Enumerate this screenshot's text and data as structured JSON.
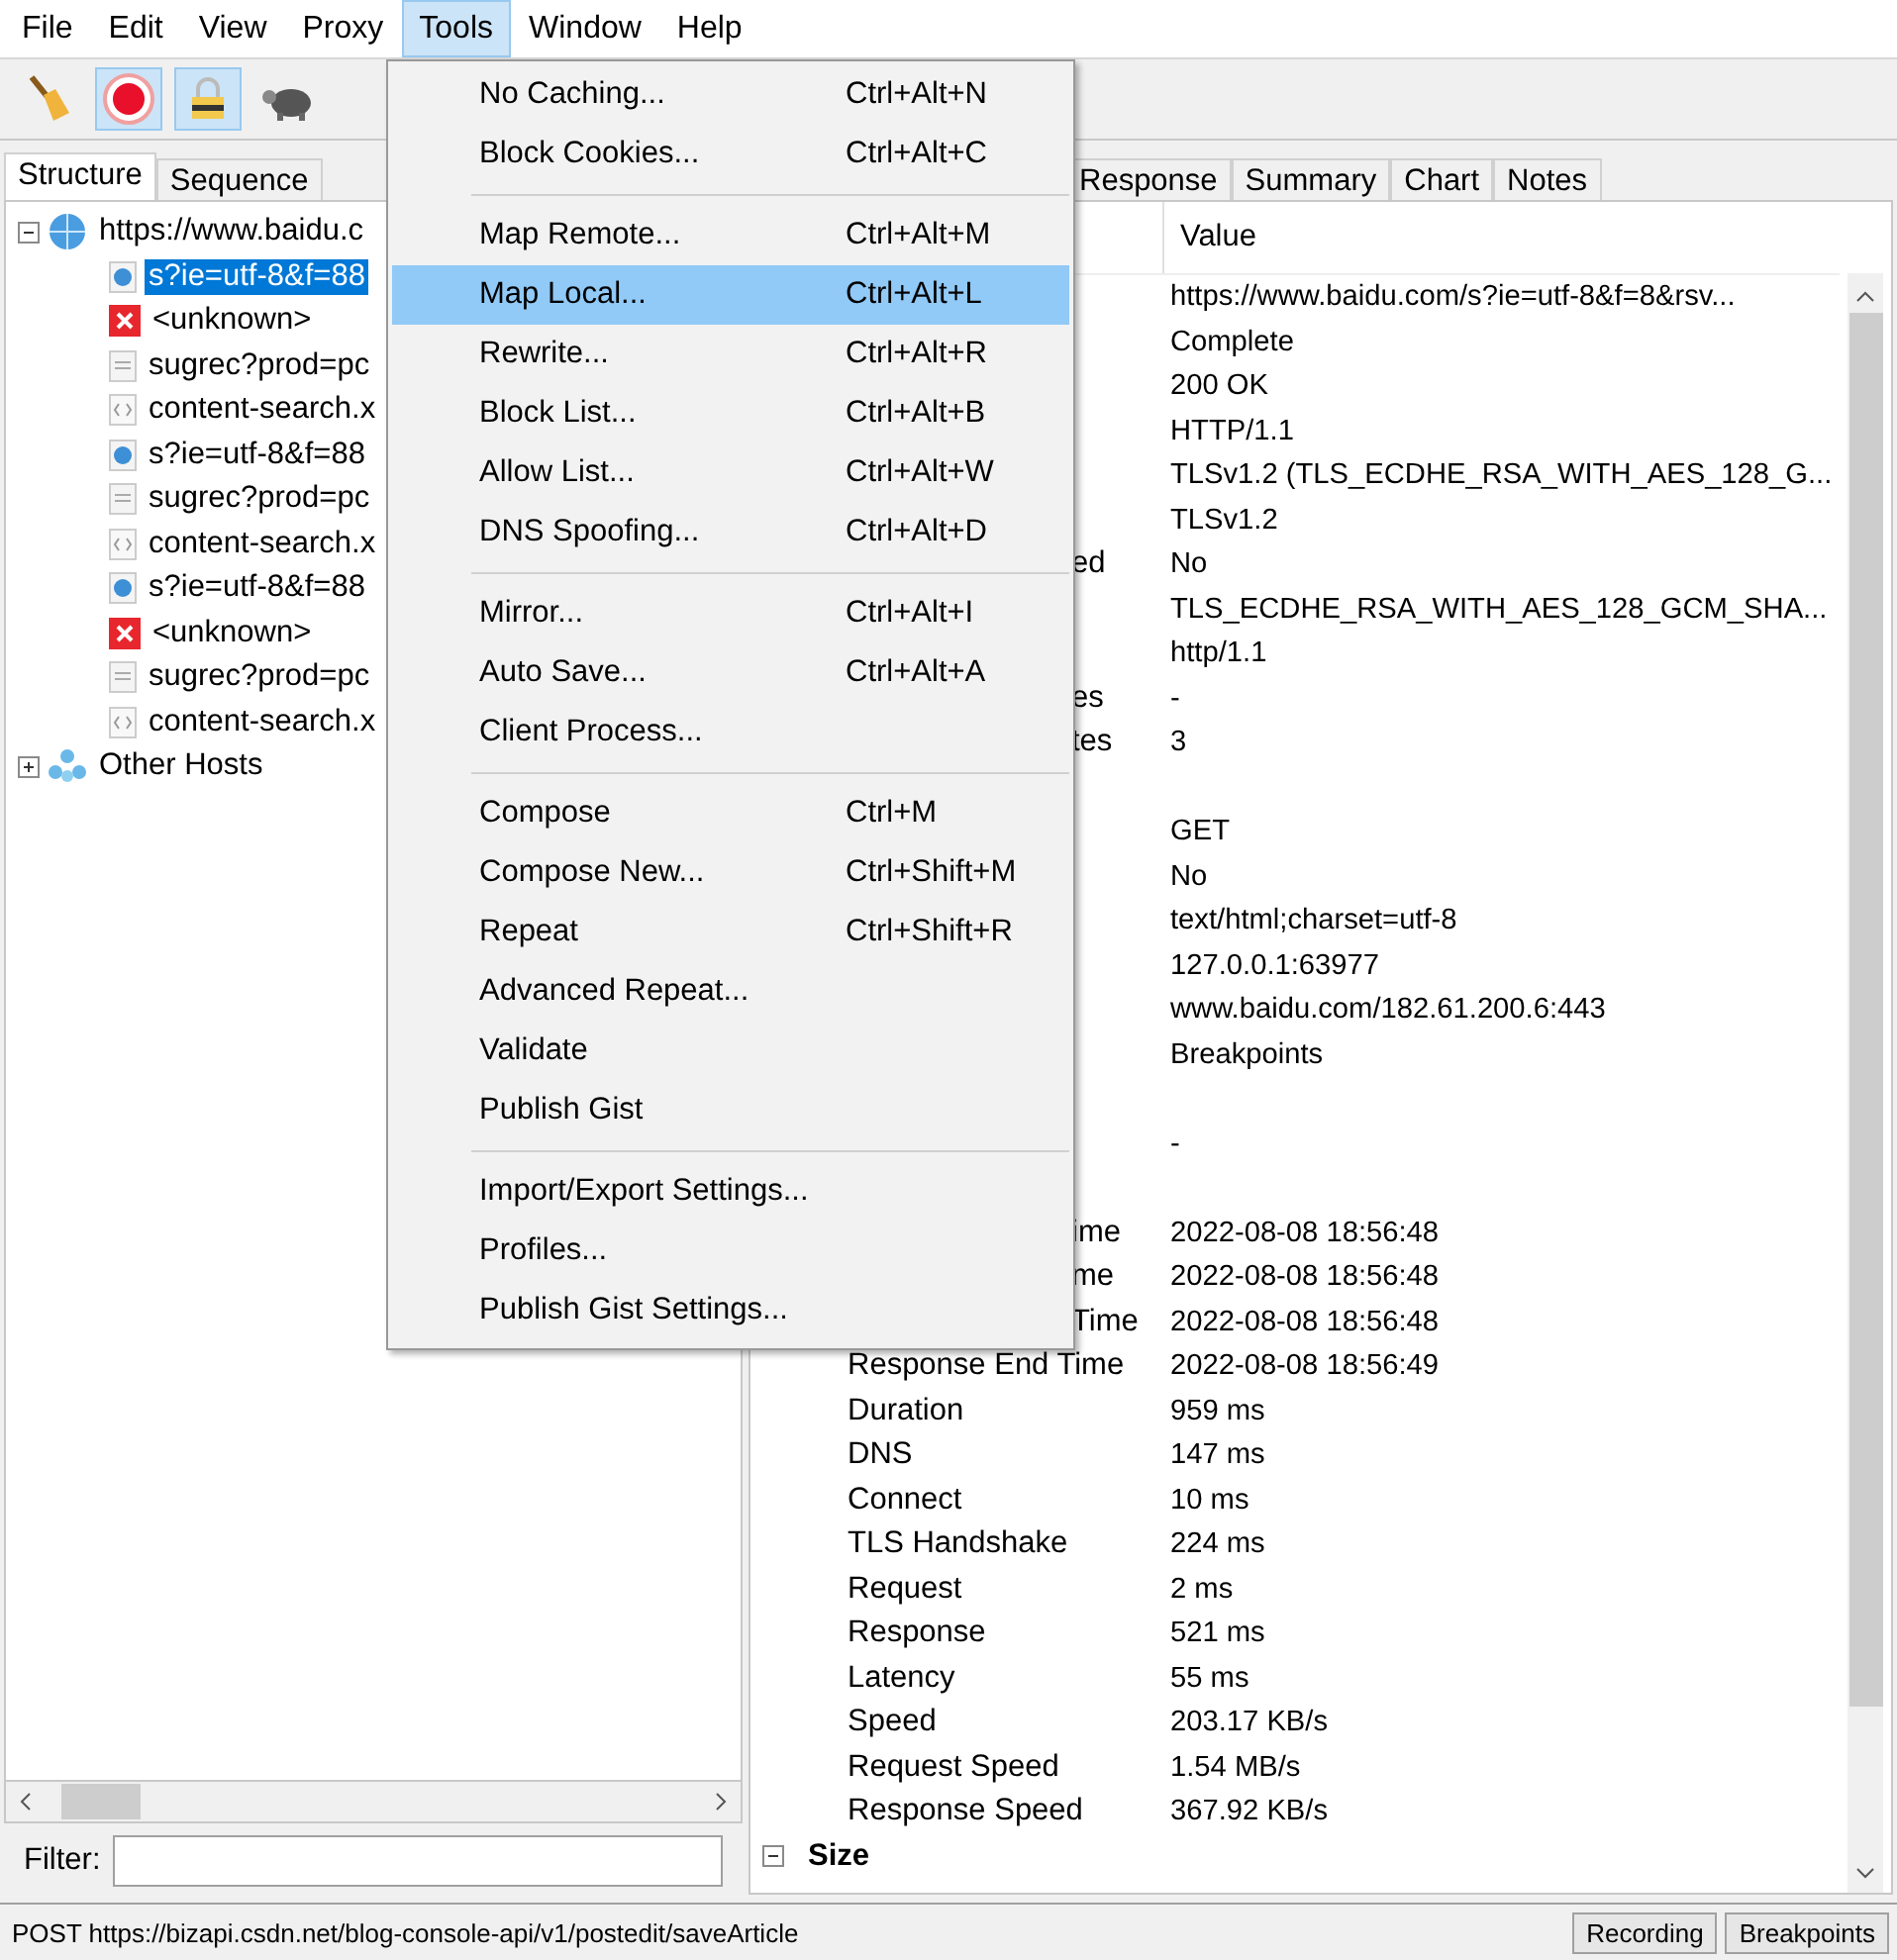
{
  "menubar": [
    {
      "label": "File",
      "selected": false
    },
    {
      "label": "Edit",
      "selected": false
    },
    {
      "label": "View",
      "selected": false
    },
    {
      "label": "Proxy",
      "selected": false
    },
    {
      "label": "Tools",
      "selected": true
    },
    {
      "label": "Window",
      "selected": false
    },
    {
      "label": "Help",
      "selected": false
    }
  ],
  "toolbar": [
    {
      "kind": "broom",
      "on": false
    },
    {
      "kind": "record",
      "on": true
    },
    {
      "kind": "ssl",
      "on": true
    },
    {
      "kind": "throttle",
      "on": false
    }
  ],
  "tools_menu": [
    {
      "kind": "item",
      "label": "No Caching...",
      "shortcut": "Ctrl+Alt+N",
      "selected": false
    },
    {
      "kind": "item",
      "label": "Block Cookies...",
      "shortcut": "Ctrl+Alt+C",
      "selected": false
    },
    {
      "kind": "separator"
    },
    {
      "kind": "item",
      "label": "Map Remote...",
      "shortcut": "Ctrl+Alt+M",
      "selected": false
    },
    {
      "kind": "item",
      "label": "Map Local...",
      "shortcut": "Ctrl+Alt+L",
      "selected": true
    },
    {
      "kind": "item",
      "label": "Rewrite...",
      "shortcut": "Ctrl+Alt+R",
      "selected": false
    },
    {
      "kind": "item",
      "label": "Block List...",
      "shortcut": "Ctrl+Alt+B",
      "selected": false
    },
    {
      "kind": "item",
      "label": "Allow List...",
      "shortcut": "Ctrl+Alt+W",
      "selected": false
    },
    {
      "kind": "item",
      "label": "DNS Spoofing...",
      "shortcut": "Ctrl+Alt+D",
      "selected": false
    },
    {
      "kind": "separator"
    },
    {
      "kind": "item",
      "label": "Mirror...",
      "shortcut": "Ctrl+Alt+I",
      "selected": false
    },
    {
      "kind": "item",
      "label": "Auto Save...",
      "shortcut": "Ctrl+Alt+A",
      "selected": false
    },
    {
      "kind": "item",
      "label": "Client Process...",
      "selected": false
    },
    {
      "kind": "separator"
    },
    {
      "kind": "item",
      "label": "Compose",
      "shortcut": "Ctrl+M",
      "selected": false
    },
    {
      "kind": "item",
      "label": "Compose New...",
      "shortcut": "Ctrl+Shift+M",
      "selected": false
    },
    {
      "kind": "item",
      "label": "Repeat",
      "shortcut": "Ctrl+Shift+R",
      "selected": false
    },
    {
      "kind": "item",
      "label": "Advanced Repeat...",
      "selected": false
    },
    {
      "kind": "item",
      "label": "Validate",
      "selected": false
    },
    {
      "kind": "item",
      "label": "Publish Gist",
      "selected": false
    },
    {
      "kind": "separator"
    },
    {
      "kind": "item",
      "label": "Import/Export Settings...",
      "selected": false
    },
    {
      "kind": "item",
      "label": "Profiles...",
      "selected": false
    },
    {
      "kind": "item",
      "label": "Publish Gist Settings...",
      "selected": false
    }
  ],
  "left_tabs": [
    {
      "label": "Structure",
      "selected": true
    },
    {
      "label": "Sequence",
      "selected": false
    }
  ],
  "tree": [
    {
      "label": "https://www.baidu.c",
      "kind": "host",
      "expanded": true,
      "children": [
        {
          "label": "s?ie=utf-8&f=88",
          "kind": "request",
          "selected": true
        },
        {
          "label": "<unknown>",
          "kind": "error",
          "selected": false
        },
        {
          "label": "sugrec?prod=pc",
          "kind": "text",
          "selected": false
        },
        {
          "label": "content-search.x",
          "kind": "code",
          "selected": false
        },
        {
          "label": "s?ie=utf-8&f=88",
          "kind": "request",
          "selected": false
        },
        {
          "label": "sugrec?prod=pc",
          "kind": "text",
          "selected": false
        },
        {
          "label": "content-search.x",
          "kind": "code",
          "selected": false
        },
        {
          "label": "s?ie=utf-8&f=88",
          "kind": "request",
          "selected": false
        },
        {
          "label": "<unknown>",
          "kind": "error",
          "selected": false
        },
        {
          "label": "sugrec?prod=pc",
          "kind": "text",
          "selected": false
        },
        {
          "label": "content-search.x",
          "kind": "code",
          "selected": false
        }
      ]
    },
    {
      "label": "Other Hosts",
      "kind": "group",
      "expanded": false
    }
  ],
  "filter": {
    "label": "Filter:"
  },
  "right_tabs": [
    {
      "label": "Response",
      "selected": false
    },
    {
      "label": "Summary",
      "selected": false
    },
    {
      "label": "Chart",
      "selected": false
    },
    {
      "label": "Notes",
      "selected": false
    }
  ],
  "table": {
    "columns": [
      "Value"
    ],
    "rows": [
      {
        "kind": "covered",
        "value": "https://www.baidu.com/s?ie=utf-8&f=8&rsv..."
      },
      {
        "kind": "covered",
        "value": "Complete"
      },
      {
        "kind": "covered",
        "value": "200 OK"
      },
      {
        "kind": "covered",
        "value": "HTTP/1.1"
      },
      {
        "kind": "covered",
        "value": "TLSv1.2 (TLS_ECDHE_RSA_WITH_AES_128_G..."
      },
      {
        "kind": "covered",
        "value": "TLSv1.2"
      },
      {
        "kind": "clipped",
        "name": "ed",
        "value": "No"
      },
      {
        "kind": "covered",
        "value": "TLS_ECDHE_RSA_WITH_AES_128_GCM_SHA..."
      },
      {
        "kind": "covered",
        "value": "http/1.1"
      },
      {
        "kind": "clipped",
        "name": "es",
        "value": "-"
      },
      {
        "kind": "clipped",
        "name": "tes",
        "value": "3"
      },
      {
        "kind": "gap"
      },
      {
        "kind": "covered",
        "value": "GET"
      },
      {
        "kind": "covered",
        "value": "No"
      },
      {
        "kind": "covered",
        "value": "text/html;charset=utf-8"
      },
      {
        "kind": "covered",
        "value": "127.0.0.1:63977"
      },
      {
        "kind": "covered",
        "value": "www.baidu.com/182.61.200.6:443"
      },
      {
        "kind": "covered",
        "value": "Breakpoints"
      },
      {
        "kind": "gap"
      },
      {
        "kind": "covered",
        "value": "-"
      },
      {
        "kind": "gap"
      },
      {
        "kind": "clipped",
        "name": "ime",
        "value": "2022-08-08 18:56:48"
      },
      {
        "kind": "clipped",
        "name": "me",
        "value": "2022-08-08 18:56:48"
      },
      {
        "kind": "clipped",
        "name": "Time",
        "value": "2022-08-08 18:56:48"
      },
      {
        "kind": "full",
        "name": "Response End Time",
        "value": "2022-08-08 18:56:49"
      },
      {
        "kind": "full",
        "name": "Duration",
        "value": "959 ms"
      },
      {
        "kind": "full",
        "name": "DNS",
        "value": "147 ms"
      },
      {
        "kind": "full",
        "name": "Connect",
        "value": "10 ms"
      },
      {
        "kind": "full",
        "name": "TLS Handshake",
        "value": "224 ms"
      },
      {
        "kind": "full",
        "name": "Request",
        "value": "2 ms"
      },
      {
        "kind": "full",
        "name": "Response",
        "value": "521 ms"
      },
      {
        "kind": "full",
        "name": "Latency",
        "value": "55 ms"
      },
      {
        "kind": "full",
        "name": "Speed",
        "value": "203.17 KB/s"
      },
      {
        "kind": "full",
        "name": "Request Speed",
        "value": "1.54 MB/s"
      },
      {
        "kind": "full",
        "name": "Response Speed",
        "value": "367.92 KB/s"
      },
      {
        "kind": "section",
        "name": "Size",
        "expanded": true
      }
    ]
  },
  "status_bar": {
    "text": "POST https://bizapi.csdn.net/blog-console-api/v1/postedit/saveArticle",
    "buttons": [
      "Recording",
      "Breakpoints"
    ]
  }
}
